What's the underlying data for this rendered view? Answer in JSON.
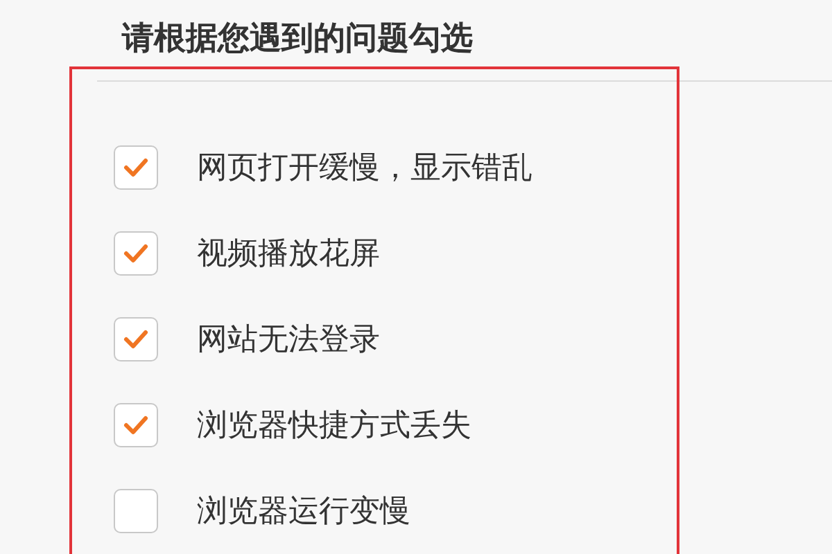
{
  "heading": "请根据您遇到的问题勾选",
  "options": [
    {
      "label": "网页打开缓慢，显示错乱",
      "checked": true
    },
    {
      "label": "视频播放花屏",
      "checked": true
    },
    {
      "label": "网站无法登录",
      "checked": true
    },
    {
      "label": "浏览器快捷方式丢失",
      "checked": true
    },
    {
      "label": "浏览器运行变慢",
      "checked": false
    }
  ]
}
